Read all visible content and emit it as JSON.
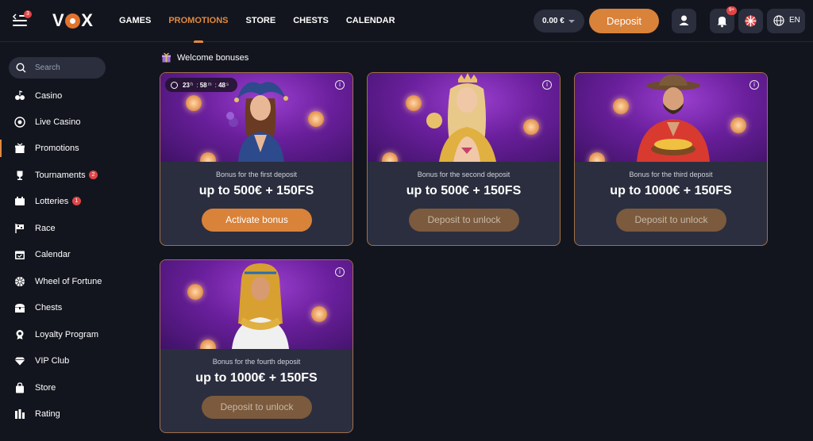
{
  "header": {
    "menu_badge": "3",
    "logo_text": "VOX",
    "nav": [
      {
        "label": "GAMES",
        "active": false
      },
      {
        "label": "PROMOTIONS",
        "active": true
      },
      {
        "label": "STORE",
        "active": false
      },
      {
        "label": "CHESTS",
        "active": false
      },
      {
        "label": "CALENDAR",
        "active": false
      }
    ],
    "balance": "0.00 €",
    "deposit_label": "Deposit",
    "notification_badge": "9+",
    "language": "EN"
  },
  "sidebar": {
    "search_placeholder": "Search",
    "items": [
      {
        "label": "Casino",
        "icon": "casino-icon"
      },
      {
        "label": "Live Casino",
        "icon": "live-casino-icon"
      },
      {
        "label": "Promotions",
        "icon": "gift-icon",
        "active": true
      },
      {
        "label": "Tournaments",
        "icon": "trophy-icon",
        "badge": "2"
      },
      {
        "label": "Lotteries",
        "icon": "lottery-icon",
        "badge": "1"
      },
      {
        "label": "Race",
        "icon": "flag-icon"
      },
      {
        "label": "Calendar",
        "icon": "calendar-icon"
      },
      {
        "label": "Wheel of Fortune",
        "icon": "wheel-icon"
      },
      {
        "label": "Chests",
        "icon": "chest-icon"
      },
      {
        "label": "Loyalty Program",
        "icon": "medal-icon"
      },
      {
        "label": "VIP Club",
        "icon": "diamond-icon"
      },
      {
        "label": "Store",
        "icon": "bag-icon"
      },
      {
        "label": "Rating",
        "icon": "rating-icon"
      }
    ]
  },
  "main": {
    "section_title": "Welcome bonuses",
    "timer": {
      "hours": "23",
      "h": "h",
      "minutes": "58",
      "m": "m",
      "seconds": "48",
      "s": "s"
    },
    "cards": [
      {
        "subtitle": "Bonus for the first deposit",
        "title": "up to 500€ + 150FS",
        "button": "Activate bonus",
        "locked": false
      },
      {
        "subtitle": "Bonus for the second deposit",
        "title": "up to 500€ + 150FS",
        "button": "Deposit to unlock",
        "locked": true
      },
      {
        "subtitle": "Bonus for the third deposit",
        "title": "up to 1000€ + 150FS",
        "button": "Deposit to unlock",
        "locked": true
      },
      {
        "subtitle": "Bonus for the fourth deposit",
        "title": "up to 1000€ + 150FS",
        "button": "Deposit to unlock",
        "locked": true
      }
    ]
  },
  "colors": {
    "accent": "#e2893f",
    "button": "#d9823a",
    "locked_button": "#7b5a3d",
    "background": "#13151e",
    "card": "#2b2e3e"
  }
}
